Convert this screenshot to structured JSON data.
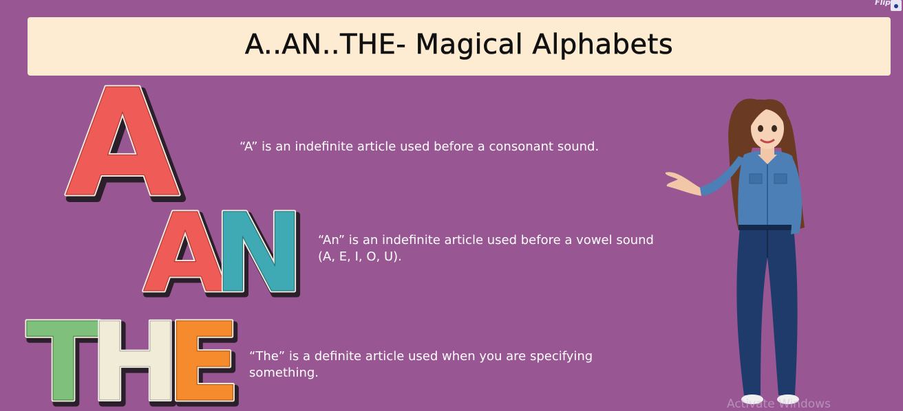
{
  "title": "A..AN..THE- Magical Alphabets",
  "corner": {
    "label": "Flip"
  },
  "articles": [
    {
      "word": "A",
      "description": "“A” is an indefinite article used before a consonant sound."
    },
    {
      "word": "AN",
      "description": "“An” is an indefinite article used before a vowel sound (A, E, I, O, U)."
    },
    {
      "word": "THE",
      "description": "“The” is a definite article used when you are specifying something."
    }
  ],
  "watermark": "Activate Windows",
  "colors": {
    "background": "#985792",
    "title_bar": "#fdecd2",
    "letter_red": "#ef5b57",
    "letter_teal": "#3fa9b4",
    "letter_green": "#7ec07c",
    "letter_cream": "#f1ecd7",
    "letter_orange": "#f68b2d"
  },
  "icons": {
    "character": "teacher-woman-illustration",
    "corner": "flip-widget-icon"
  }
}
